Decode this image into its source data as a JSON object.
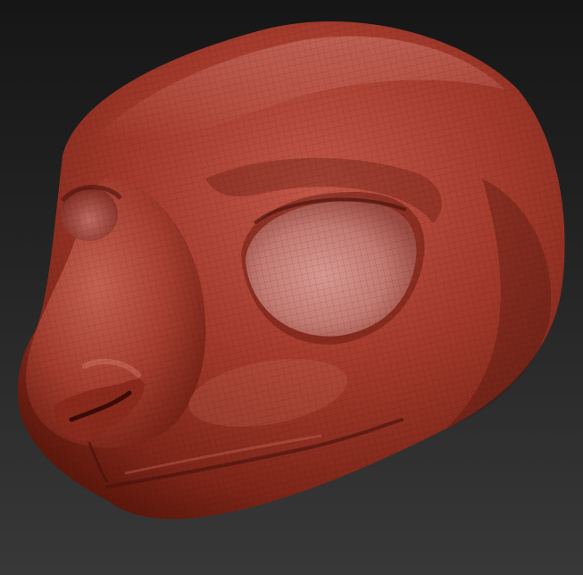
{
  "viewport": {
    "background_top": "#161616",
    "background_bottom": "#383838"
  },
  "model": {
    "subject": "sculpted-animal-head-mask",
    "material_color": "#a0392b",
    "highlight_color": "#d98a80",
    "shadow_color": "#4a130c",
    "wireframe_visible": true
  }
}
